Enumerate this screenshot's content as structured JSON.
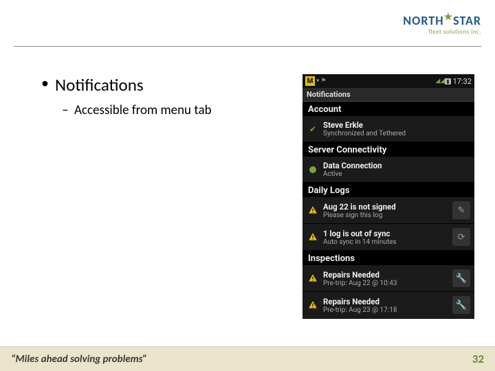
{
  "logo": {
    "main": "NORTH",
    "main2": "STAR",
    "sub": "fleet solutions inc."
  },
  "slide": {
    "bullet1": "Notifications",
    "bullet2": "Accessible from menu tab"
  },
  "phone": {
    "status": {
      "m": "M",
      "time": "17:32"
    },
    "titlebar": "Notifications",
    "sections": {
      "account": {
        "head": "Account",
        "item": {
          "title": "Steve Erkle",
          "sub": "Synchronized and Tethered"
        }
      },
      "server": {
        "head": "Server Connectivity",
        "item": {
          "title": "Data Connection",
          "sub": "Active"
        }
      },
      "logs": {
        "head": "Daily Logs",
        "item1": {
          "title": "Aug 22 is not signed",
          "sub": "Please sign this log"
        },
        "item2": {
          "title": "1 log is out of sync",
          "sub": "Auto sync in 14 minutes"
        }
      },
      "inspections": {
        "head": "Inspections",
        "item1": {
          "title": "Repairs Needed",
          "sub": "Pre-trip: Aug 22 @ 10:43"
        },
        "item2": {
          "title": "Repairs Needed",
          "sub": "Pre-trip: Aug 23 @ 17:18"
        }
      }
    }
  },
  "footer": {
    "tagline": "“Miles ahead solving problems”",
    "page": "32"
  }
}
